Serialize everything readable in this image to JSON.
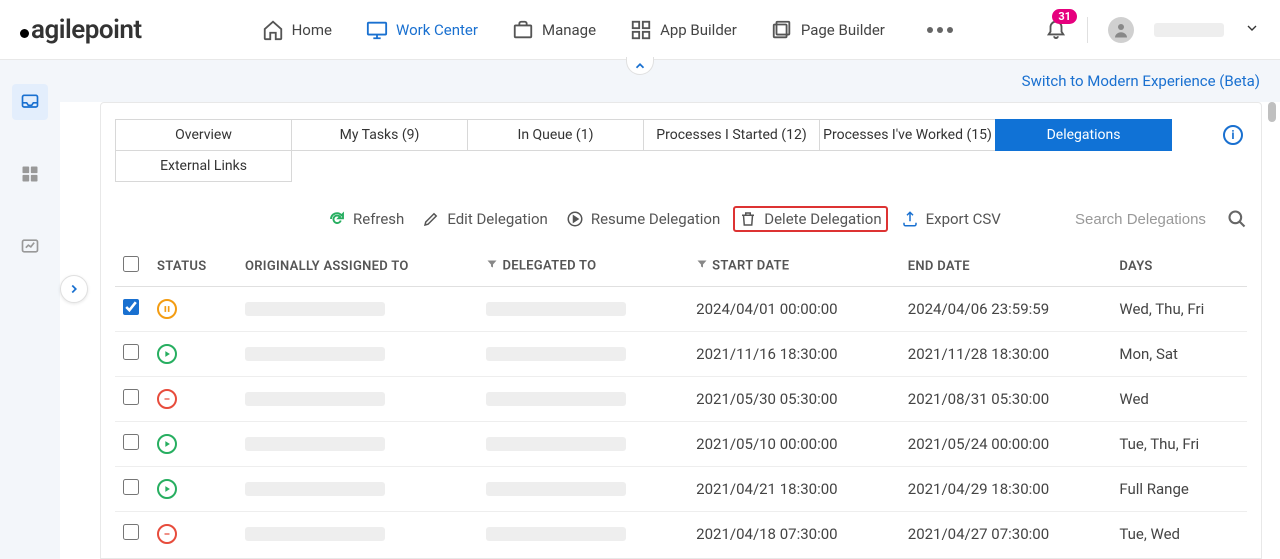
{
  "nav": {
    "home": "Home",
    "work_center": "Work Center",
    "manage": "Manage",
    "app_builder": "App Builder",
    "page_builder": "Page Builder"
  },
  "notifications": {
    "count": "31"
  },
  "banner": {
    "switch": "Switch to Modern Experience (Beta)"
  },
  "tabs": {
    "overview": "Overview",
    "my_tasks": "My Tasks (9)",
    "in_queue": "In Queue (1)",
    "processes_started": "Processes I Started (12)",
    "processes_worked": "Processes I've Worked (15)",
    "delegations": "Delegations",
    "external_links": "External Links"
  },
  "toolbar": {
    "refresh": "Refresh",
    "edit": "Edit Delegation",
    "resume": "Resume Delegation",
    "delete": "Delete Delegation",
    "export": "Export CSV",
    "search_placeholder": "Search Delegations"
  },
  "columns": {
    "status": "STATUS",
    "originally": "ORIGINALLY ASSIGNED TO",
    "delegated": "DELEGATED TO",
    "start": "START DATE",
    "end": "END DATE",
    "days": "DAYS"
  },
  "rows": [
    {
      "checked": true,
      "status": "pause",
      "start": "2024/04/01 00:00:00",
      "end": "2024/04/06 23:59:59",
      "days": "Wed, Thu, Fri"
    },
    {
      "checked": false,
      "status": "play",
      "start": "2021/11/16 18:30:00",
      "end": "2021/11/28 18:30:00",
      "days": "Mon, Sat"
    },
    {
      "checked": false,
      "status": "stop",
      "start": "2021/05/30 05:30:00",
      "end": "2021/08/31 05:30:00",
      "days": "Wed"
    },
    {
      "checked": false,
      "status": "play",
      "start": "2021/05/10 00:00:00",
      "end": "2021/05/24 00:00:00",
      "days": "Tue, Thu, Fri"
    },
    {
      "checked": false,
      "status": "play",
      "start": "2021/04/21 18:30:00",
      "end": "2021/04/29 18:30:00",
      "days": "Full Range"
    },
    {
      "checked": false,
      "status": "stop",
      "start": "2021/04/18 07:30:00",
      "end": "2021/04/27 07:30:00",
      "days": "Tue, Wed"
    }
  ]
}
